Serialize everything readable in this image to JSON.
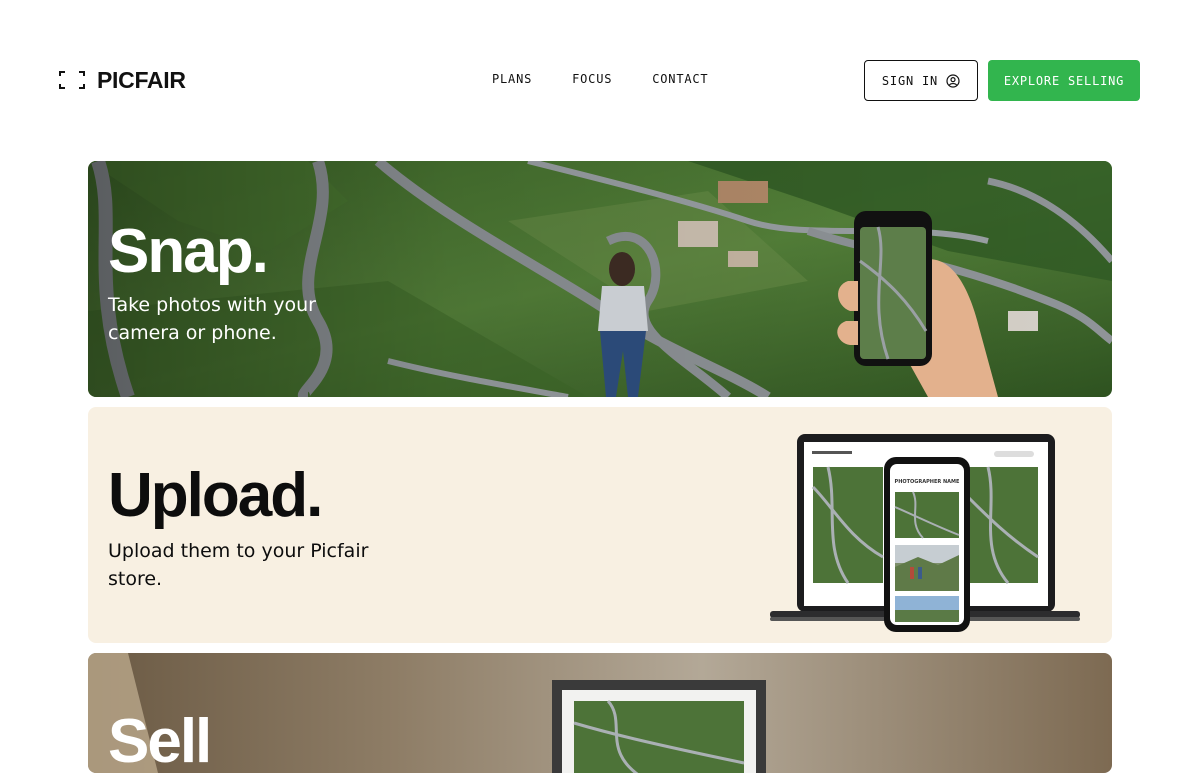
{
  "header": {
    "logo_text": "PICFAIR",
    "nav": [
      "PLANS",
      "FOCUS",
      "CONTACT"
    ],
    "sign_in_label": "SIGN IN",
    "explore_label": "EXPLORE SELLING"
  },
  "cards": {
    "snap": {
      "title": "Snap.",
      "description": "Take photos with your camera or phone."
    },
    "upload": {
      "title": "Upload.",
      "description": "Upload them to your Picfair store.",
      "device_caption": "PHOTOGRAPHER NAME"
    },
    "sell": {
      "title": "Sell"
    }
  },
  "colors": {
    "accent": "#32b54e",
    "upload_bg": "#f8f0e2"
  }
}
